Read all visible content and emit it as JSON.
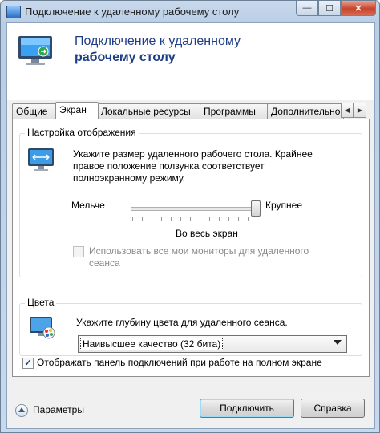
{
  "window": {
    "title": "Подключение к удаленному рабочему столу",
    "minimize_glyph": "—",
    "maximize_glyph": "☐",
    "close_glyph": "✕"
  },
  "header": {
    "line1": "Подключение к удаленному",
    "line2": "рабочему столу",
    "icon": "remote-desktop-computer-icon"
  },
  "tabs": [
    {
      "label": "Общие"
    },
    {
      "label": "Экран",
      "active": true
    },
    {
      "label": "Локальные ресурсы"
    },
    {
      "label": "Программы"
    },
    {
      "label": "Дополнительно"
    }
  ],
  "tab_scroll": {
    "left": "◀",
    "right": "▶"
  },
  "display": {
    "group_title": "Настройка отображения",
    "description_lines": [
      "Укажите размер удаленного рабочего стола. Крайнее",
      "правое положение ползунка соответствует",
      "полноэкранному режиму."
    ],
    "slider_min_label": "Мельче",
    "slider_max_label": "Крупнее",
    "slider_value_label": "Во весь экран",
    "slider_position": 1.0,
    "monitors_checkbox": {
      "line1": "Использовать все мои мониторы для удаленного",
      "line2": "сеанса",
      "checked": false,
      "enabled": false
    }
  },
  "colors": {
    "group_title": "Цвета",
    "description": "Укажите глубину цвета для удаленного сеанса.",
    "selected_option": "Наивысшее качество (32 бита)"
  },
  "connection_bar_checkbox": {
    "label": "Отображать панель подключений при работе на полном экране",
    "checked": true,
    "check_glyph": "✓"
  },
  "footer": {
    "options_label": "Параметры",
    "connect_label": "Подключить",
    "help_label": "Справка"
  },
  "theme": {
    "title_text": "#1e3d87",
    "close_button": "#c8432b",
    "accent": "#3c7fb1"
  }
}
